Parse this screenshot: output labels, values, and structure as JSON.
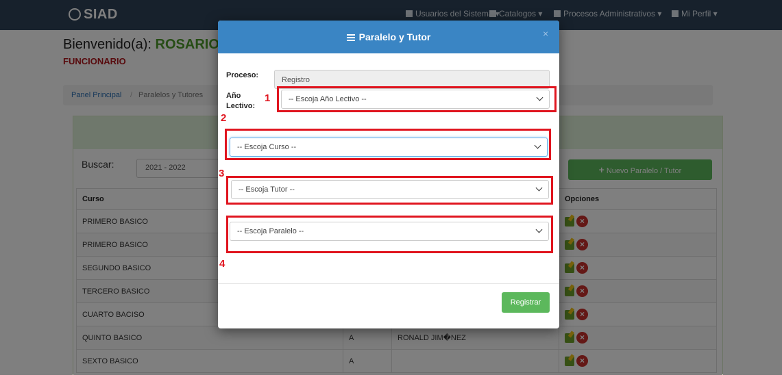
{
  "navbar": {
    "brand": "SIAD",
    "items": [
      {
        "label": "Usuarios del Sistema ▾"
      },
      {
        "label": "Catalogos ▾"
      },
      {
        "label": "Procesos Administrativos ▾"
      },
      {
        "label": "Mi Perfil ▾"
      }
    ]
  },
  "header": {
    "welcome_prefix": "Bienvenido(a):",
    "user_name": "ROSARIO",
    "role": "FUNCIONARIO"
  },
  "breadcrumb": {
    "home": "Panel Principal",
    "separator": "/",
    "current": "Paralelos y Tutores"
  },
  "toolbar": {
    "search_label": "Buscar:",
    "search_value": "2021 - 2022",
    "new_button": "Nuevo Paralelo / Tutor"
  },
  "table": {
    "headers": {
      "curso": "Curso",
      "opciones": "Opciones"
    },
    "rows": [
      {
        "curso": "PRIMERO BASICO",
        "paralelo": "",
        "tutor": ""
      },
      {
        "curso": "PRIMERO BASICO",
        "paralelo": "",
        "tutor": ""
      },
      {
        "curso": "SEGUNDO BASICO",
        "paralelo": "",
        "tutor": ""
      },
      {
        "curso": "TERCERO BASICO",
        "paralelo": "",
        "tutor": ""
      },
      {
        "curso": "CUARTO BACISO",
        "paralelo": "",
        "tutor": ""
      },
      {
        "curso": "QUINTO BASICO",
        "paralelo": "A",
        "tutor": "RONALD JIM�NEZ"
      },
      {
        "curso": "SEXTO BASICO",
        "paralelo": "A",
        "tutor": ""
      }
    ]
  },
  "modal": {
    "title": "Paralelo y Tutor",
    "close": "×",
    "proceso_label": "Proceso:",
    "proceso_value": "Registro",
    "anio_label_1": "Año",
    "anio_label_2": "Lectivo:",
    "anio_placeholder": "-- Escoja Año Lectivo --",
    "curso_placeholder": "-- Escoja Curso --",
    "tutor_placeholder": "-- Escoja Tutor --",
    "paralelo_placeholder": "-- Escoja Paralelo --",
    "submit": "Registrar"
  },
  "annotations": {
    "n1": "1",
    "n2": "2",
    "n3": "3",
    "n4": "4",
    "color": "#e0151f"
  },
  "colors": {
    "navbar": "#2f4358",
    "modal_header": "#3a85c4",
    "success": "#5cb85c",
    "welcome_name": "#4c9a2a",
    "role": "#b0161c"
  }
}
